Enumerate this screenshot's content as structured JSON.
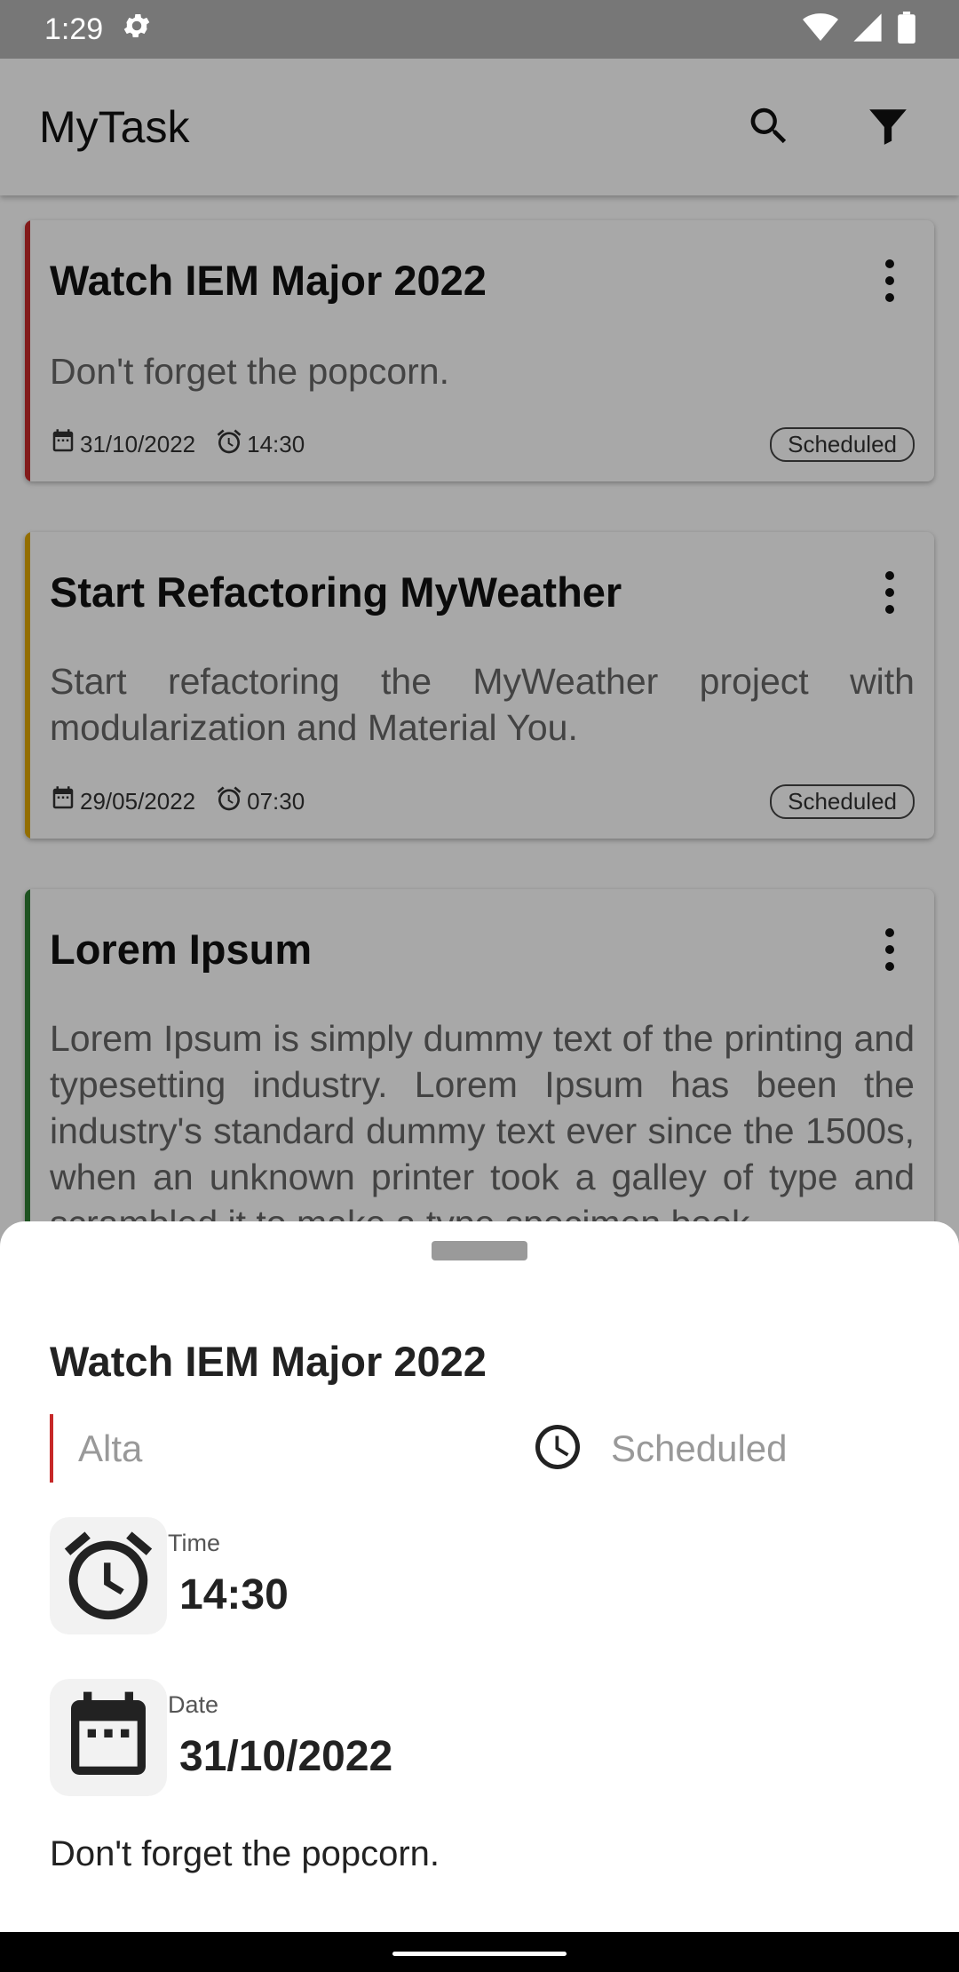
{
  "status_bar": {
    "time": "1:29",
    "icons": [
      "gear-icon",
      "wifi-icon",
      "signal-icon",
      "battery-icon"
    ]
  },
  "app_bar": {
    "title": "MyTask",
    "actions": [
      "search-icon",
      "filter-icon"
    ]
  },
  "tasks": [
    {
      "title": "Watch IEM Major 2022",
      "description": "Don't forget the popcorn.",
      "date": "31/10/2022",
      "time": "14:30",
      "status": "Scheduled",
      "accent": "#c62828"
    },
    {
      "title": "Start Refactoring MyWeather",
      "description": "Start refactoring the MyWeather project with modularization and Material You.",
      "date": "29/05/2022",
      "time": "07:30",
      "status": "Scheduled",
      "accent": "#e0a800"
    },
    {
      "title": "Lorem Ipsum",
      "description": "Lorem Ipsum is simply dummy text of the printing and typesetting industry. Lorem Ipsum has been the industry's standard dummy text ever since the 1500s, when an unknown printer took a galley of type and scrambled it to make a type specimen book.",
      "accent": "#2e7d32"
    }
  ],
  "sheet": {
    "title": "Watch IEM Major 2022",
    "priority": "Alta",
    "priority_color": "#c62828",
    "status": "Scheduled",
    "time_caption": "Time",
    "time_value": "14:30",
    "date_caption": "Date",
    "date_value": "31/10/2022",
    "description": "Don't forget the popcorn."
  }
}
